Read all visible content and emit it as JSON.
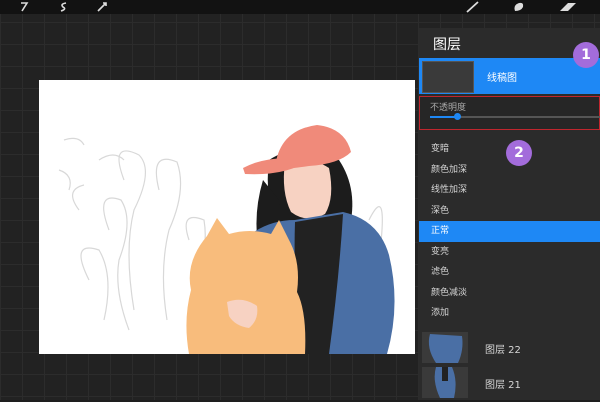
{
  "toolbar": {
    "left_tools": [
      "adjustments-icon",
      "selection-icon",
      "transform-icon"
    ],
    "right_tools": [
      "brush-icon",
      "smudge-icon",
      "eraser-icon"
    ]
  },
  "layers_panel": {
    "title": "图层",
    "selected_layer": "线稿图",
    "opacity_label": "不透明度",
    "opacity_value": 0.16,
    "blend_modes": [
      "变暗",
      "颜色加深",
      "线性加深",
      "深色",
      "正常",
      "变亮",
      "滤色",
      "颜色减淡",
      "添加"
    ],
    "active_blend_mode": "正常",
    "layers": [
      "图层 22",
      "图层 21"
    ]
  },
  "annotations": [
    "1",
    "2"
  ],
  "colors": {
    "accent": "#1e88f5",
    "highlight_border": "#c0262e",
    "badge": "#a36cdb",
    "cap": "#f08a7a",
    "jacket": "#4a6fa5",
    "cat": "#f8bc7c"
  }
}
